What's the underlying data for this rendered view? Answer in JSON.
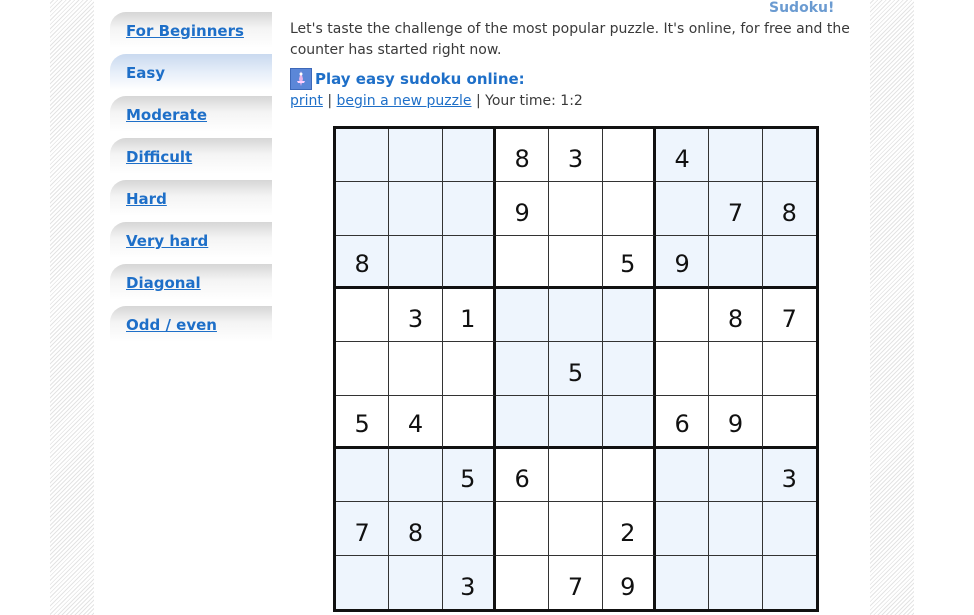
{
  "header": {
    "title": "Sudoku!"
  },
  "sidebar": {
    "items": [
      {
        "label": "For Beginners",
        "active": false
      },
      {
        "label": "Easy",
        "active": true
      },
      {
        "label": "Moderate",
        "active": false
      },
      {
        "label": "Difficult",
        "active": false
      },
      {
        "label": "Hard",
        "active": false
      },
      {
        "label": "Very hard",
        "active": false
      },
      {
        "label": "Diagonal",
        "active": false
      },
      {
        "label": "Odd / even",
        "active": false
      }
    ]
  },
  "main": {
    "intro": "Let's taste the challenge of the most popular puzzle. It's online, for free and the counter has started right now.",
    "play_heading": "Play easy sudoku online:",
    "print_link": "print",
    "new_puzzle_link": "begin a new puzzle",
    "separator": "|",
    "timer_label": "Your time:",
    "timer_value": "1:2"
  },
  "colors": {
    "link": "#1e6fc8",
    "shaded_box": "#eef5fd",
    "title": "#6b9bd1"
  },
  "puzzle": {
    "rows": [
      [
        "",
        "",
        "",
        "8",
        "3",
        "",
        "4",
        "",
        ""
      ],
      [
        "",
        "",
        "",
        "9",
        "",
        "",
        "",
        "7",
        "8"
      ],
      [
        "8",
        "",
        "",
        "",
        "",
        "5",
        "9",
        "",
        ""
      ],
      [
        "",
        "3",
        "1",
        "",
        "",
        "",
        "",
        "8",
        "7"
      ],
      [
        "",
        "",
        "",
        "",
        "5",
        "",
        "",
        "",
        ""
      ],
      [
        "5",
        "4",
        "",
        "",
        "",
        "",
        "6",
        "9",
        ""
      ],
      [
        "",
        "",
        "5",
        "6",
        "",
        "",
        "",
        "",
        "3"
      ],
      [
        "7",
        "8",
        "",
        "",
        "",
        "2",
        "",
        "",
        ""
      ],
      [
        "",
        "",
        "3",
        "",
        "7",
        "9",
        "",
        "",
        ""
      ]
    ]
  }
}
